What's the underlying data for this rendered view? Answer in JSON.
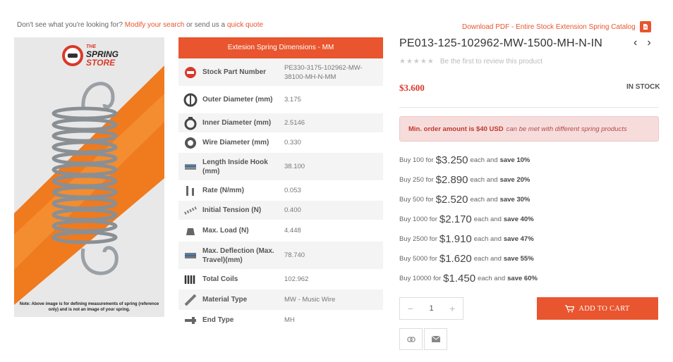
{
  "topbar": {
    "prefix": "Don't see what you're looking for?",
    "modify_link": "Modify your search",
    "middle": "or send us a",
    "quote_link": "quick quote",
    "download": "Download PDF - Entire Stock Extension Spring Catalog",
    "download_icon": "pdf-icon"
  },
  "image": {
    "logo_the": "THE",
    "logo_spring": "SPRING",
    "logo_store": "STORE",
    "note": "Note: Above image is for defining measurements of spring (reference only) and is not an image of your spring."
  },
  "dimensions": {
    "header": "Extesion Spring Dimensions - MM",
    "rows": [
      {
        "icon": "part-number-icon",
        "label": "Stock Part Number",
        "value": "PE330-3175-102962-MW-38100-MH-N-MM"
      },
      {
        "icon": "outer-diameter-icon",
        "label": "Outer Diameter (mm)",
        "value": "3.175"
      },
      {
        "icon": "inner-diameter-icon",
        "label": "Inner Diameter (mm)",
        "value": "2.5146"
      },
      {
        "icon": "wire-diameter-icon",
        "label": "Wire Diameter (mm)",
        "value": "0.330"
      },
      {
        "icon": "length-inside-hook-icon",
        "label": "Length Inside Hook (mm)",
        "value": "38.100"
      },
      {
        "icon": "rate-icon",
        "label": "Rate (N/mm)",
        "value": "0.053"
      },
      {
        "icon": "initial-tension-icon",
        "label": "Initial Tension (N)",
        "value": "0.400"
      },
      {
        "icon": "max-load-icon",
        "label": "Max. Load (N)",
        "value": "4.448"
      },
      {
        "icon": "max-deflection-icon",
        "label": "Max. Deflection (Max. Travel)(mm)",
        "value": "78.740"
      },
      {
        "icon": "total-coils-icon",
        "label": "Total Coils",
        "value": "102.962"
      },
      {
        "icon": "material-type-icon",
        "label": "Material Type",
        "value": "MW - Music Wire"
      },
      {
        "icon": "end-type-icon",
        "label": "End Type",
        "value": "MH"
      }
    ]
  },
  "product": {
    "title": "PE013-125-102962-MW-1500-MH-N-IN",
    "prev": "‹",
    "next": "›",
    "stars": "★★★★★",
    "review_text": "Be the first to review this product",
    "price": "$3.600",
    "stock": "IN STOCK",
    "min_order_bold": "Min. order amount is $40 USD",
    "min_order_italic": "can be met with different spring products",
    "tiers": [
      {
        "qty": "Buy 100 for",
        "price": "$3.250",
        "each": "each and",
        "save": "save 10%"
      },
      {
        "qty": "Buy 250 for",
        "price": "$2.890",
        "each": "each and",
        "save": "save 20%"
      },
      {
        "qty": "Buy 500 for",
        "price": "$2.520",
        "each": "each and",
        "save": "save 30%"
      },
      {
        "qty": "Buy 1000 for",
        "price": "$2.170",
        "each": "each and",
        "save": "save 40%"
      },
      {
        "qty": "Buy 2500 for",
        "price": "$1.910",
        "each": "each and",
        "save": "save 47%"
      },
      {
        "qty": "Buy 5000 for",
        "price": "$1.620",
        "each": "each and",
        "save": "save 55%"
      },
      {
        "qty": "Buy 10000 for",
        "price": "$1.450",
        "each": "each and",
        "save": "save 60%"
      }
    ],
    "quantity": "1",
    "minus": "−",
    "plus": "+",
    "add_to_cart": "ADD TO CART",
    "compare_icon": "compare-icon",
    "email_icon": "envelope-icon"
  },
  "colors": {
    "accent": "#e8552e",
    "price": "#d9392a",
    "min_order_bg": "#f7dcdc"
  }
}
